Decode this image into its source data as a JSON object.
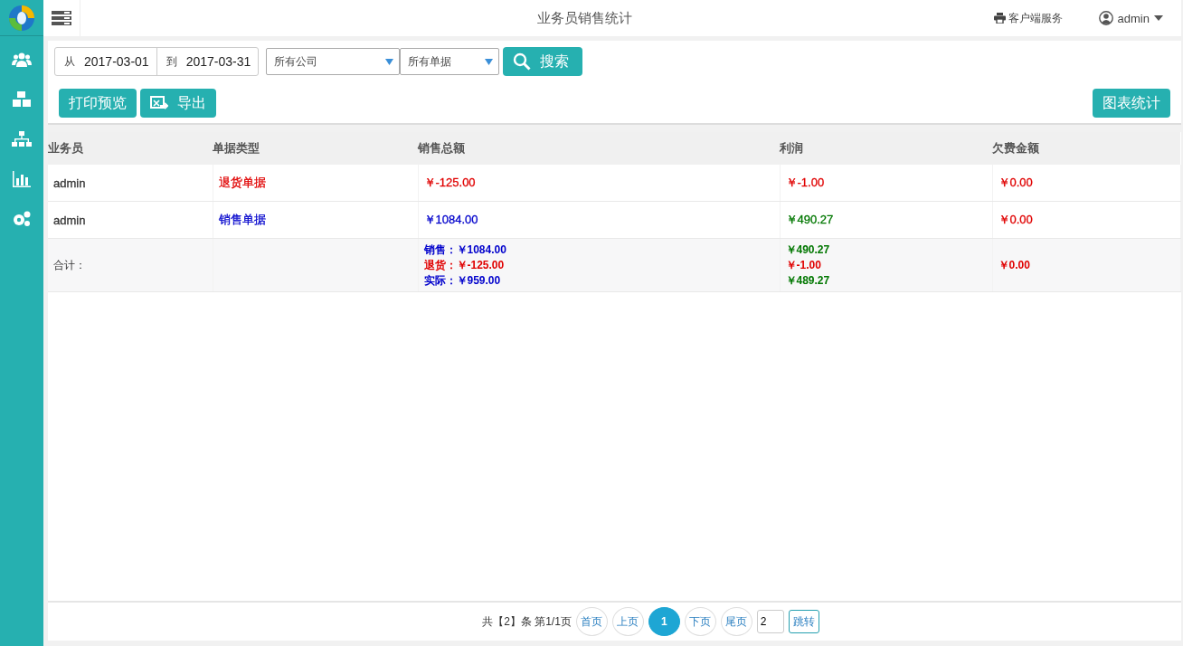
{
  "header": {
    "title": "业务员销售统计",
    "client_service": "客户端服务",
    "user": "admin"
  },
  "sidebar": {
    "items": [
      {
        "selected": false
      },
      {
        "selected": false
      },
      {
        "selected": false
      },
      {
        "selected": false
      },
      {
        "selected": false
      }
    ]
  },
  "filters": {
    "from_label": "从",
    "from_date": "2017-03-01",
    "to_label": "到",
    "to_date": "2017-03-31",
    "company": "所有公司",
    "doc_type": "所有单据",
    "search_button": "搜索"
  },
  "actions": {
    "print_preview": "打印预览",
    "export": "导出",
    "chart_stats": "图表统计"
  },
  "table": {
    "columns": [
      "业务员",
      "单据类型",
      "销售总额",
      "利润",
      "欠费金额"
    ],
    "rows": [
      {
        "cells": [
          {
            "text": "admin",
            "color": "#333333"
          },
          {
            "text": "退货单据",
            "color": "#e00000"
          },
          {
            "text": "￥-125.00",
            "color": "#e00000"
          },
          {
            "text": "￥-1.00",
            "color": "#e00000"
          },
          {
            "text": "￥0.00",
            "color": "#e00000"
          }
        ]
      },
      {
        "cells": [
          {
            "text": "admin",
            "color": "#333333"
          },
          {
            "text": "销售单据",
            "color": "#0000cc"
          },
          {
            "text": "￥1084.00",
            "color": "#0000cc"
          },
          {
            "text": "￥490.27",
            "color": "#007700"
          },
          {
            "text": "￥0.00",
            "color": "#e00000"
          }
        ]
      }
    ],
    "total": {
      "label": "合计：",
      "cells": [
        {
          "lines": [
            {
              "text": "销售：￥1084.00",
              "color": "#0000cc"
            },
            {
              "text": "退货：￥-125.00",
              "color": "#e00000"
            },
            {
              "text": "实际：￥959.00",
              "color": "#0000cc"
            }
          ]
        },
        {
          "lines": [
            {
              "text": "￥490.27",
              "color": "#007700"
            },
            {
              "text": "￥-1.00",
              "color": "#e00000"
            },
            {
              "text": "￥489.27",
              "color": "#007700"
            }
          ]
        },
        {
          "lines": [
            {
              "text": "￥0.00",
              "color": "#e00000"
            }
          ]
        }
      ]
    }
  },
  "pagination": {
    "summary": "共【2】条 第1/1页",
    "buttons": [
      {
        "label": "首页",
        "selected": false
      },
      {
        "label": "上页",
        "selected": false
      },
      {
        "label": "1",
        "selected": true
      },
      {
        "label": "下页",
        "selected": false
      },
      {
        "label": "尾页",
        "selected": false
      }
    ],
    "page_input": "2",
    "jump_button": "跳转"
  }
}
